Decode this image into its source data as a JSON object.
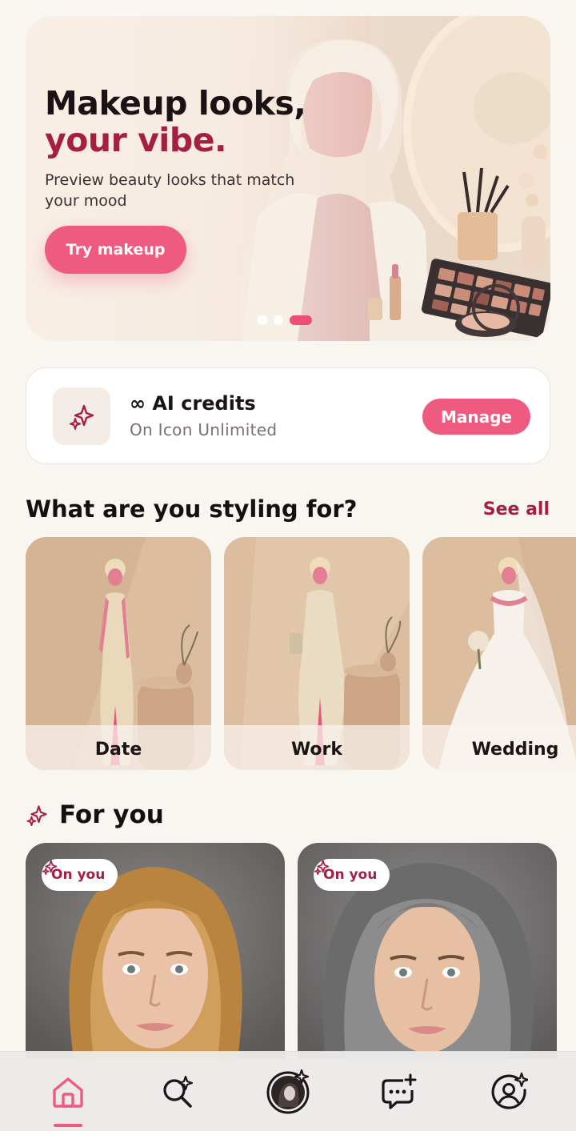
{
  "colors": {
    "accent": "#ef5a80",
    "accent_dark": "#a51f45",
    "background": "#f9f5f0"
  },
  "hero": {
    "title_line1": "Makeup looks,",
    "title_line2": "your vibe.",
    "subtitle": "Preview beauty looks that match your mood",
    "cta_label": "Try makeup",
    "slides_total": 3,
    "active_slide": 3
  },
  "credits": {
    "title": "∞ AI credits",
    "subtitle": "On Icon Unlimited",
    "manage_label": "Manage",
    "icon": "sparkle-icon"
  },
  "occasions": {
    "title": "What are you styling for?",
    "see_all_label": "See all",
    "items": [
      {
        "label": "Date"
      },
      {
        "label": "Work"
      },
      {
        "label": "Wedding"
      }
    ]
  },
  "for_you": {
    "title": "For you",
    "icon": "sparkle-icon",
    "cards": [
      {
        "badge": "On you",
        "hair": "blonde"
      },
      {
        "badge": "On you",
        "hair": "silver"
      }
    ]
  },
  "bottom_nav": {
    "items": [
      {
        "icon": "home-icon",
        "active": true
      },
      {
        "icon": "sparkle-search-icon",
        "active": false
      },
      {
        "icon": "avatar-sparkle-icon",
        "active": false
      },
      {
        "icon": "chat-plus-icon",
        "active": false
      },
      {
        "icon": "profile-sparkle-icon",
        "active": false
      }
    ]
  }
}
